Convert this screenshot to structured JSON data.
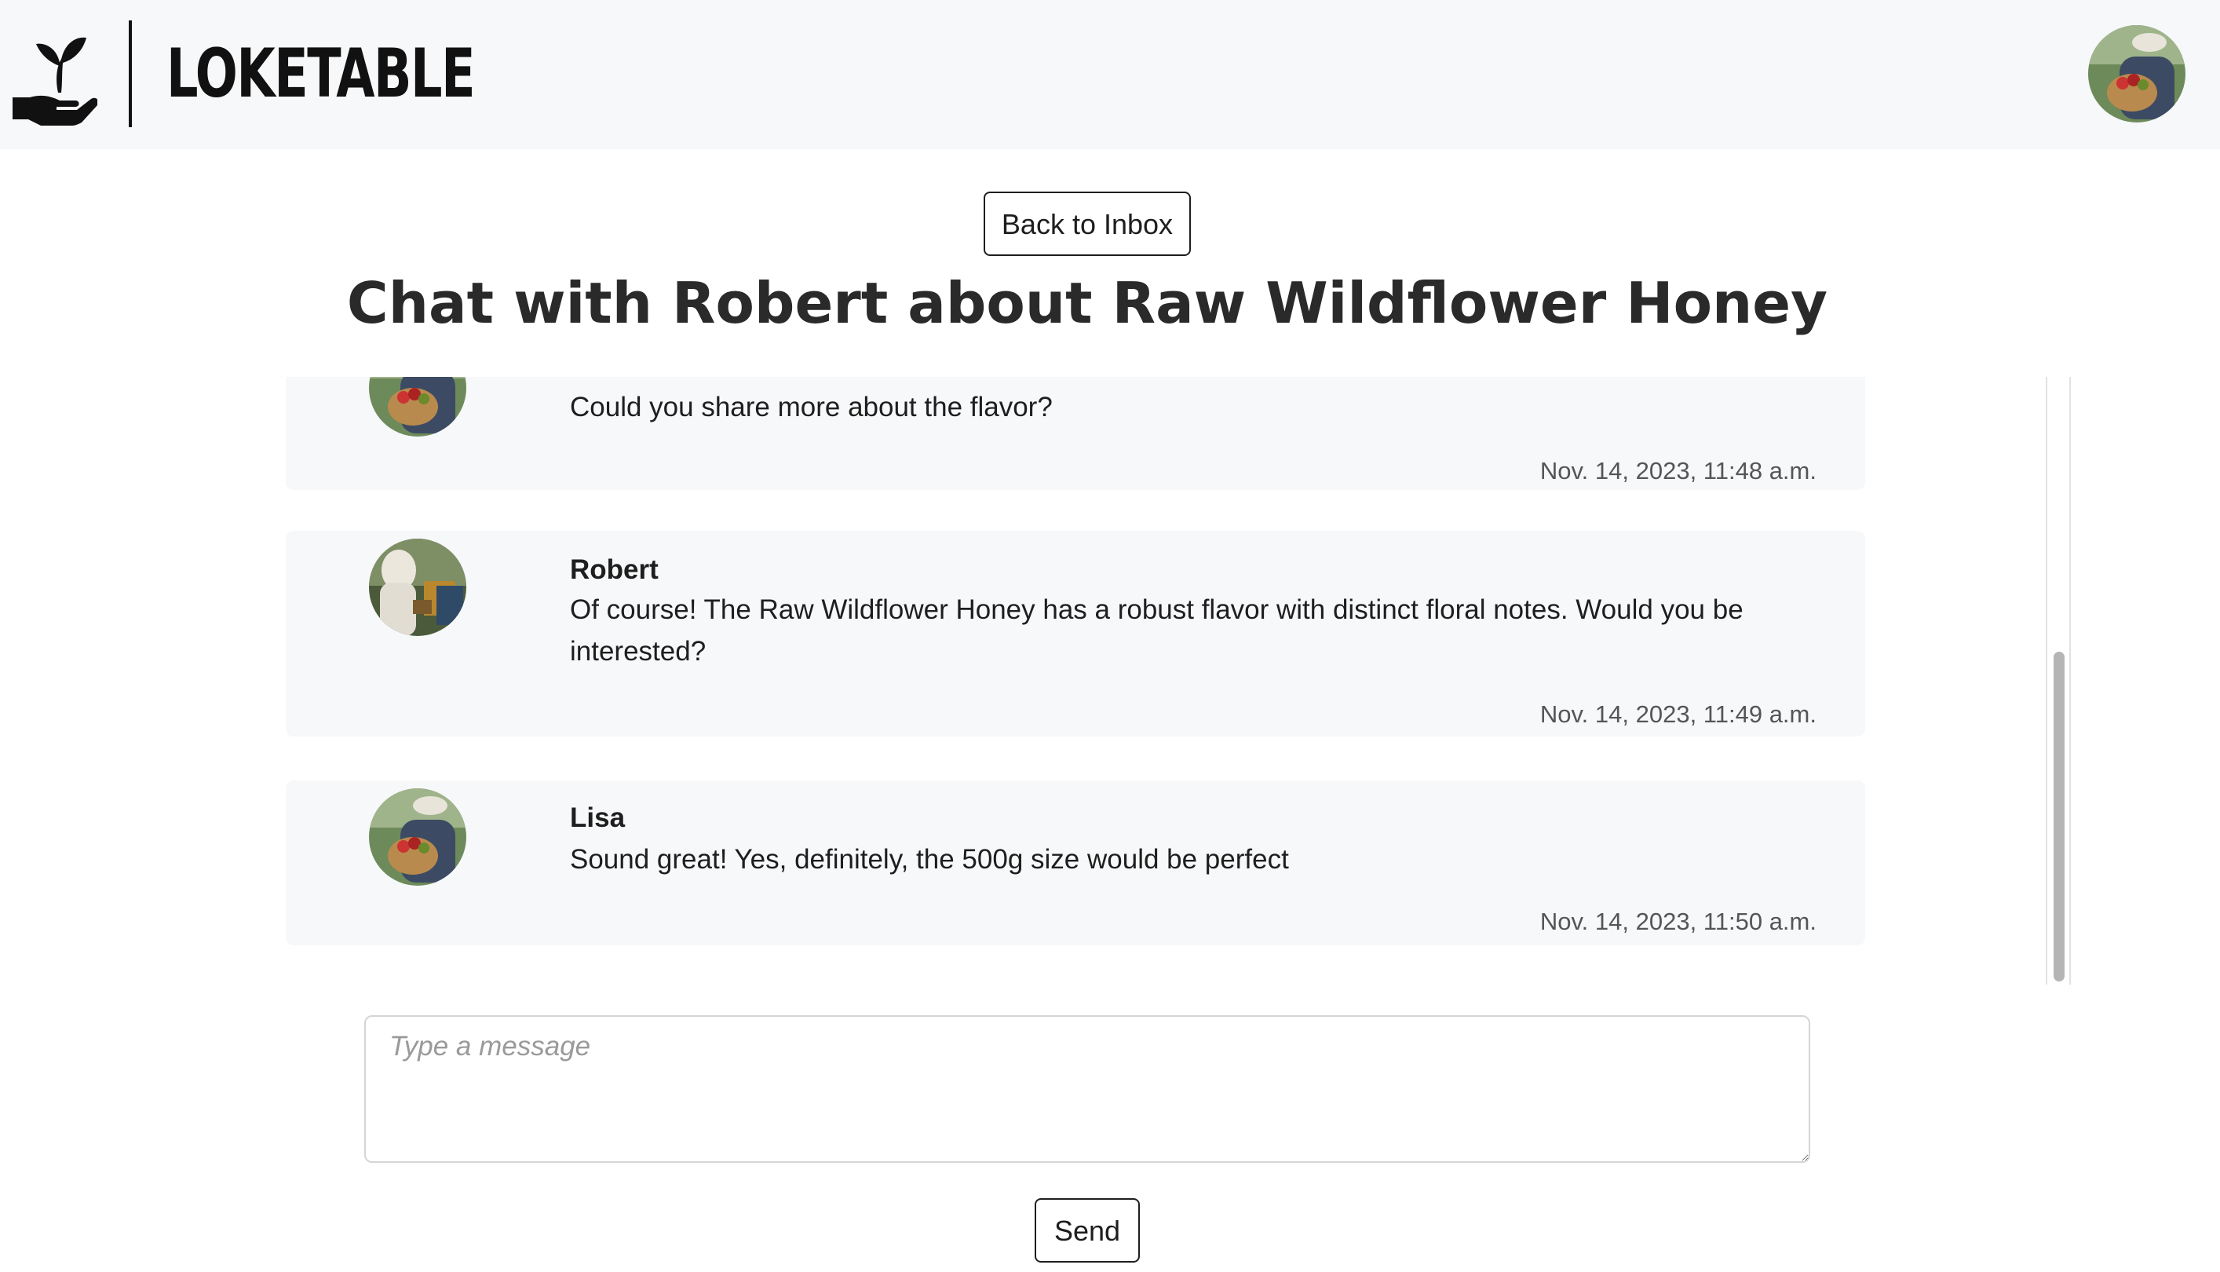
{
  "app": {
    "name": "LOKETABLE"
  },
  "header": {
    "user_avatar": "user-avatar-icon"
  },
  "back_button": {
    "label": "Back to Inbox"
  },
  "page_title": "Chat with Robert about Raw Wildflower Honey",
  "messages": [
    {
      "sender": "",
      "text": "Could you share more about the flavor?",
      "time": "Nov. 14, 2023, 11:48 a.m."
    },
    {
      "sender": "Robert",
      "text": "Of course! The Raw Wildflower Honey has a robust flavor with distinct floral notes. Would you be interested?",
      "time": "Nov. 14, 2023, 11:49 a.m."
    },
    {
      "sender": "Lisa",
      "text": "Sound great! Yes, definitely, the 500g size would be perfect",
      "time": "Nov. 14, 2023, 11:50 a.m."
    }
  ],
  "composer": {
    "placeholder": "Type a message",
    "value": ""
  },
  "send_button": {
    "label": "Send"
  }
}
